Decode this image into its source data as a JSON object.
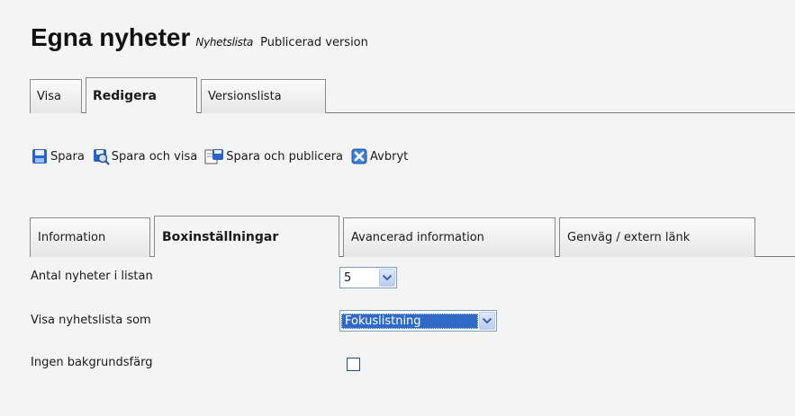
{
  "header": {
    "title": "Egna nyheter",
    "page_type": "Nyhetslista",
    "version": "Publicerad version"
  },
  "main_tabs": [
    {
      "label": "Visa",
      "active": false
    },
    {
      "label": "Redigera",
      "active": true
    },
    {
      "label": "Versionslista",
      "active": false
    }
  ],
  "toolbar": {
    "save": {
      "label": "Spara",
      "icon": "floppy-disk-icon"
    },
    "save_view": {
      "label": "Spara och visa",
      "icon": "save-view-icon"
    },
    "save_publish": {
      "label": "Spara och publicera",
      "icon": "save-publish-icon"
    },
    "cancel": {
      "label": "Avbryt",
      "icon": "cancel-x-icon"
    }
  },
  "sub_tabs": [
    {
      "label": "Information",
      "active": false
    },
    {
      "label": "Boxinställningar",
      "active": true
    },
    {
      "label": "Avancerad information",
      "active": false
    },
    {
      "label": "Genväg / extern länk",
      "active": false
    }
  ],
  "form": {
    "news_count": {
      "label": "Antal nyheter i listan",
      "value": "5"
    },
    "display_as": {
      "label": "Visa nyhetslista som",
      "value": "Fokuslistning"
    },
    "no_background": {
      "label": "Ingen bakgrundsfärg",
      "checked": false
    }
  },
  "colors": {
    "select_highlight": "#3169c6",
    "icon_blue": "#2a62c9",
    "cancel_blue": "#3a7fd8"
  }
}
